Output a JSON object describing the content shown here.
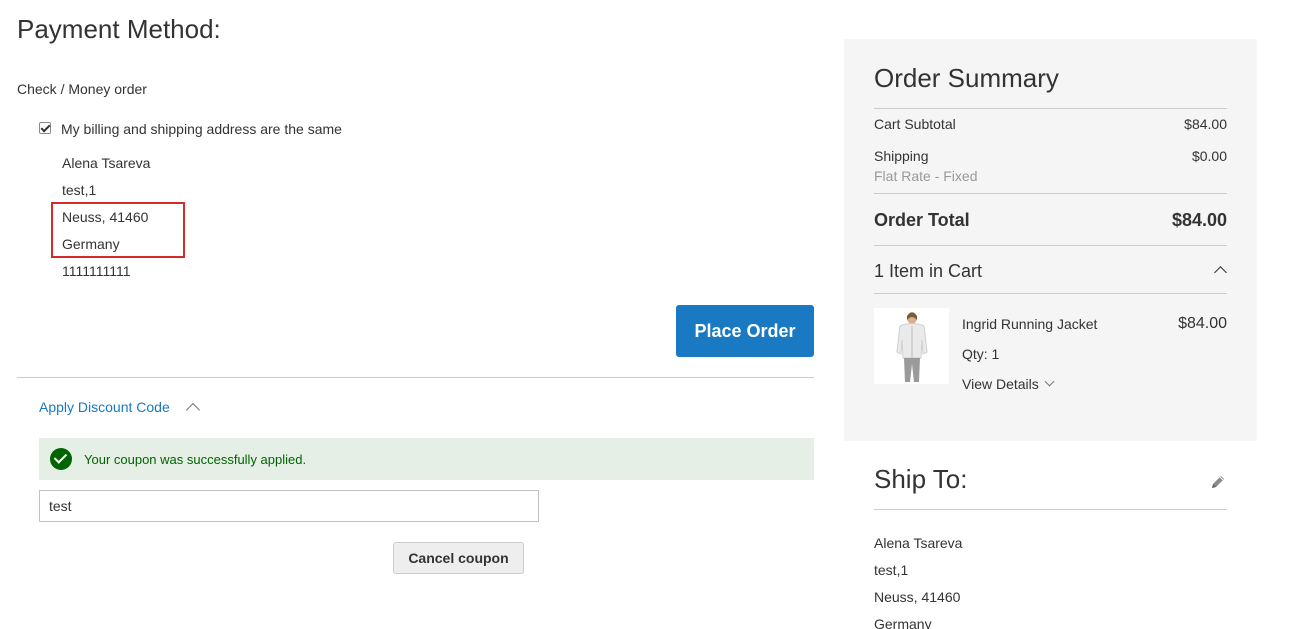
{
  "payment": {
    "title": "Payment Method:",
    "method_label": "Check / Money order",
    "same_address_label": "My billing and shipping address are the same",
    "same_address_checked": true,
    "address": [
      "Alena Tsareva",
      "test,1",
      "Neuss, 41460",
      "Germany",
      "1111111111"
    ],
    "place_order_label": "Place Order"
  },
  "discount": {
    "toggle_label": "Apply Discount Code",
    "success_message": "Your coupon was successfully applied.",
    "coupon_value": "test",
    "cancel_label": "Cancel coupon"
  },
  "summary": {
    "title": "Order Summary",
    "cart_subtotal_label": "Cart Subtotal",
    "cart_subtotal_value": "$84.00",
    "shipping_label": "Shipping",
    "shipping_value": "$0.00",
    "shipping_method": "Flat Rate - Fixed",
    "order_total_label": "Order Total",
    "order_total_value": "$84.00",
    "items_in_cart": "1 Item in Cart",
    "item": {
      "name": "Ingrid Running Jacket",
      "price": "$84.00",
      "qty": "Qty: 1",
      "view_details": "View Details"
    }
  },
  "ship_to": {
    "title": "Ship To:",
    "address": [
      "Alena Tsareva",
      "test,1",
      "Neuss, 41460",
      "Germany"
    ]
  },
  "colors": {
    "primary": "#1979c3",
    "success_bg": "#e5efe5",
    "success_text": "#006400",
    "highlight": "#d62b2b",
    "summary_bg": "#f5f5f5"
  }
}
